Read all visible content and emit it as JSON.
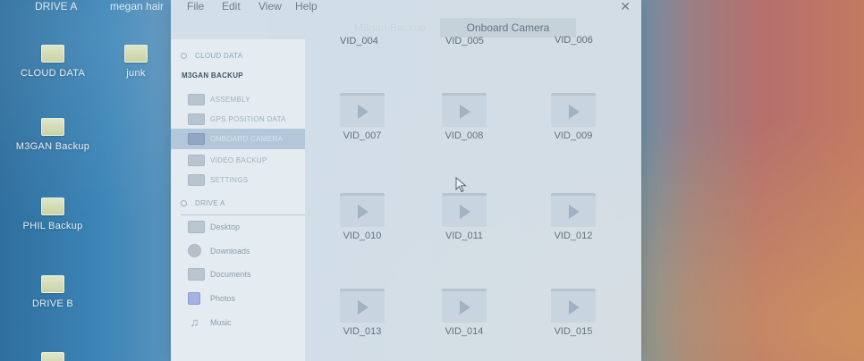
{
  "desktop": {
    "top_labels": [
      "DRIVE A",
      "megan hair"
    ],
    "icons": [
      {
        "label": "CLOUD DATA"
      },
      {
        "label": "junk"
      },
      {
        "label": "M3GAN Backup"
      },
      {
        "label": "PHIL Backup"
      },
      {
        "label": "DRIVE B"
      }
    ]
  },
  "window": {
    "menu": [
      "File",
      "Edit",
      "View",
      "Help"
    ],
    "close_icon": "close-icon",
    "sidebar": {
      "cloud_header": "CLOUD DATA",
      "group_title": "M3GAN BACKUP",
      "items": [
        {
          "label": "ASSEMBLY"
        },
        {
          "label": "GPS POSITION DATA"
        },
        {
          "label": "ONBOARD CAMERA",
          "active": true
        },
        {
          "label": "VIDEO BACKUP"
        },
        {
          "label": "SETTINGS"
        }
      ],
      "drive_header": "DRIVE A",
      "places": [
        {
          "label": "Desktop",
          "icon": "desktop-folder-icon"
        },
        {
          "label": "Downloads",
          "icon": "downloads-icon"
        },
        {
          "label": "Documents",
          "icon": "documents-folder-icon"
        },
        {
          "label": "Photos",
          "icon": "photos-icon"
        },
        {
          "label": "Music",
          "icon": "music-icon"
        }
      ]
    },
    "tabs": {
      "inactive": "M3gan Backup",
      "active": "Onboard Camera"
    },
    "top_videos": [
      "VID_004",
      "VID_005",
      "VID_006"
    ],
    "videos": [
      "VID_007",
      "VID_008",
      "VID_009",
      "VID_010",
      "VID_011",
      "VID_012",
      "VID_013",
      "VID_014",
      "VID_015"
    ]
  },
  "colors": {
    "active_item_bg": "#8ea7c4",
    "window_bg": "#dee6ec"
  }
}
